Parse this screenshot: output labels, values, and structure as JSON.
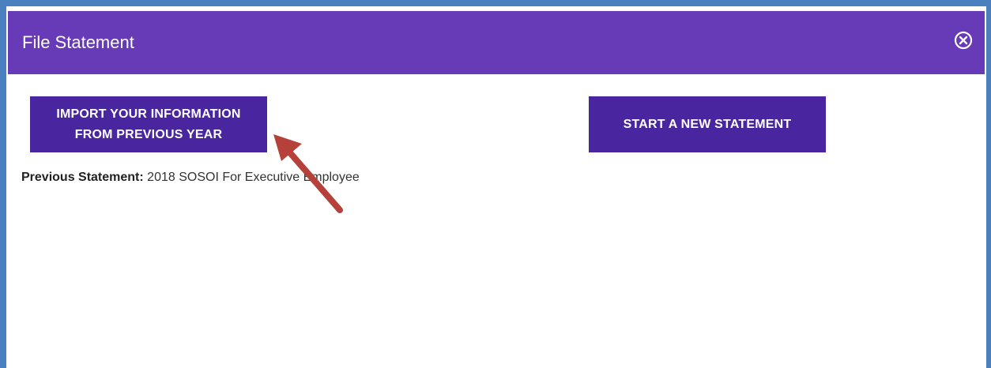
{
  "modal": {
    "title": "File Statement",
    "close_icon": "close-circle-icon"
  },
  "buttons": {
    "import_line1": "IMPORT YOUR INFORMATION",
    "import_line2": "FROM PREVIOUS YEAR",
    "new_statement": "START A NEW STATEMENT"
  },
  "previous_statement": {
    "label": "Previous Statement:",
    "value": "2018 SOSOI For Executive Employee"
  },
  "annotation": {
    "icon": "red-arrow-icon",
    "color": "#b5413a"
  },
  "colors": {
    "header": "#673ab7",
    "button": "#4a25a0",
    "frame_border": "#4a7fc0"
  }
}
